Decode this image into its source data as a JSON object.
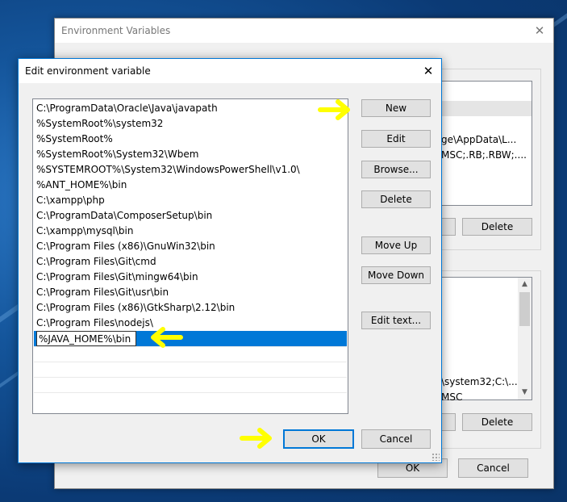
{
  "back_window": {
    "title": "Environment Variables",
    "user_list_fragments": [
      "ge\\AppData\\L...",
      "MSC;.RB;.RBW;...."
    ],
    "user_delete_label": "Delete",
    "system_list_fragments": [
      "\\system32;C:\\...",
      "MSC"
    ],
    "system_delete_label": "Delete",
    "ok_label": "OK",
    "cancel_label": "Cancel"
  },
  "dialog": {
    "title": "Edit environment variable",
    "paths": [
      "C:\\ProgramData\\Oracle\\Java\\javapath",
      "%SystemRoot%\\system32",
      "%SystemRoot%",
      "%SystemRoot%\\System32\\Wbem",
      "%SYSTEMROOT%\\System32\\WindowsPowerShell\\v1.0\\",
      "%ANT_HOME%\\bin",
      "C:\\xampp\\php",
      "C:\\ProgramData\\ComposerSetup\\bin",
      "C:\\xampp\\mysql\\bin",
      "C:\\Program Files (x86)\\GnuWin32\\bin",
      "C:\\Program Files\\Git\\cmd",
      "C:\\Program Files\\Git\\mingw64\\bin",
      "C:\\Program Files\\Git\\usr\\bin",
      "C:\\Program Files (x86)\\GtkSharp\\2.12\\bin",
      "C:\\Program Files\\nodejs\\"
    ],
    "editing_value": "%JAVA_HOME%\\bin",
    "buttons": {
      "new": "New",
      "edit": "Edit",
      "browse": "Browse...",
      "delete": "Delete",
      "move_up": "Move Up",
      "move_down": "Move Down",
      "edit_text": "Edit text...",
      "ok": "OK",
      "cancel": "Cancel"
    }
  },
  "colors": {
    "selection": "#0078d7",
    "highlight_arrow": "#ffff00",
    "accent_border": "#0078d7"
  },
  "icons": [
    "close-icon",
    "arrow-right-icon",
    "arrow-left-icon",
    "scroll-up-icon",
    "scroll-down-icon",
    "resize-grip-icon"
  ]
}
